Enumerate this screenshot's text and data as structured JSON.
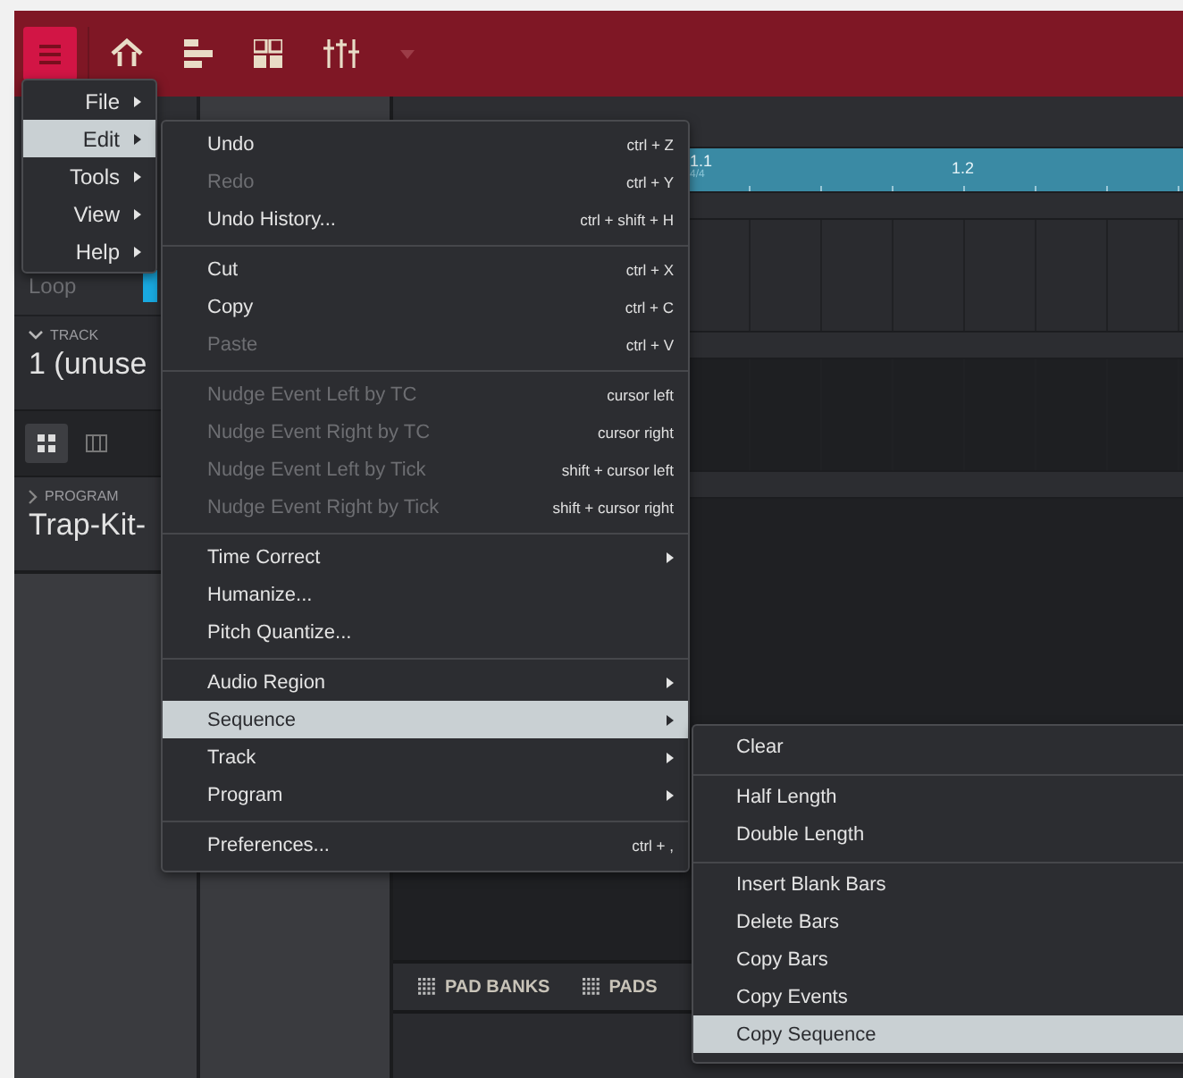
{
  "main_menu": [
    {
      "label": "File",
      "selected": false
    },
    {
      "label": "Edit",
      "selected": true
    },
    {
      "label": "Tools",
      "selected": false
    },
    {
      "label": "View",
      "selected": false
    },
    {
      "label": "Help",
      "selected": false
    }
  ],
  "edit_menu": [
    [
      {
        "label": "Undo",
        "shortcut": "ctrl + Z",
        "disabled": false,
        "submenu": false,
        "selected": false
      },
      {
        "label": "Redo",
        "shortcut": "ctrl + Y",
        "disabled": true,
        "submenu": false,
        "selected": false
      },
      {
        "label": "Undo History...",
        "shortcut": "ctrl + shift + H",
        "disabled": false,
        "submenu": false,
        "selected": false
      }
    ],
    [
      {
        "label": "Cut",
        "shortcut": "ctrl + X",
        "disabled": false,
        "submenu": false,
        "selected": false
      },
      {
        "label": "Copy",
        "shortcut": "ctrl + C",
        "disabled": false,
        "submenu": false,
        "selected": false
      },
      {
        "label": "Paste",
        "shortcut": "ctrl + V",
        "disabled": true,
        "submenu": false,
        "selected": false
      }
    ],
    [
      {
        "label": "Nudge Event Left by TC",
        "shortcut": "cursor left",
        "disabled": true,
        "submenu": false,
        "selected": false
      },
      {
        "label": "Nudge Event Right by TC",
        "shortcut": "cursor right",
        "disabled": true,
        "submenu": false,
        "selected": false
      },
      {
        "label": "Nudge Event Left by Tick",
        "shortcut": "shift + cursor left",
        "disabled": true,
        "submenu": false,
        "selected": false
      },
      {
        "label": "Nudge Event Right by Tick",
        "shortcut": "shift + cursor right",
        "disabled": true,
        "submenu": false,
        "selected": false
      }
    ],
    [
      {
        "label": "Time Correct",
        "disabled": false,
        "submenu": true,
        "selected": false
      },
      {
        "label": "Humanize...",
        "disabled": false,
        "submenu": false,
        "selected": false
      },
      {
        "label": "Pitch Quantize...",
        "disabled": false,
        "submenu": false,
        "selected": false
      }
    ],
    [
      {
        "label": "Audio Region",
        "disabled": false,
        "submenu": true,
        "selected": false
      },
      {
        "label": "Sequence",
        "disabled": false,
        "submenu": true,
        "selected": true
      },
      {
        "label": "Track",
        "disabled": false,
        "submenu": true,
        "selected": false
      },
      {
        "label": "Program",
        "disabled": false,
        "submenu": true,
        "selected": false
      }
    ],
    [
      {
        "label": "Preferences...",
        "shortcut": "ctrl + ,",
        "disabled": false,
        "submenu": false,
        "selected": false
      }
    ]
  ],
  "sequence_menu": [
    [
      {
        "label": "Clear",
        "selected": false
      }
    ],
    [
      {
        "label": "Half Length",
        "selected": false
      },
      {
        "label": "Double Length",
        "selected": false
      }
    ],
    [
      {
        "label": "Insert Blank Bars",
        "selected": false
      },
      {
        "label": "Delete Bars",
        "selected": false
      },
      {
        "label": "Copy Bars",
        "selected": false
      },
      {
        "label": "Copy Events",
        "selected": false
      },
      {
        "label": "Copy Sequence",
        "selected": true
      }
    ]
  ],
  "left_panel": {
    "loop_label": "Loop",
    "loop_on": true,
    "track_label": "TRACK",
    "track_name": "1 (unuse",
    "program_label": "PROGRAM",
    "program_name": "Trap-Kit-",
    "view_buttons": [
      {
        "kind": "grid",
        "selected": true
      },
      {
        "kind": "keys",
        "selected": false
      }
    ]
  },
  "timeline": {
    "bar": "1.1",
    "time_signature": "4/4",
    "beat": "1.2"
  },
  "bottom_tabs": [
    "PAD BANKS",
    "PADS"
  ]
}
